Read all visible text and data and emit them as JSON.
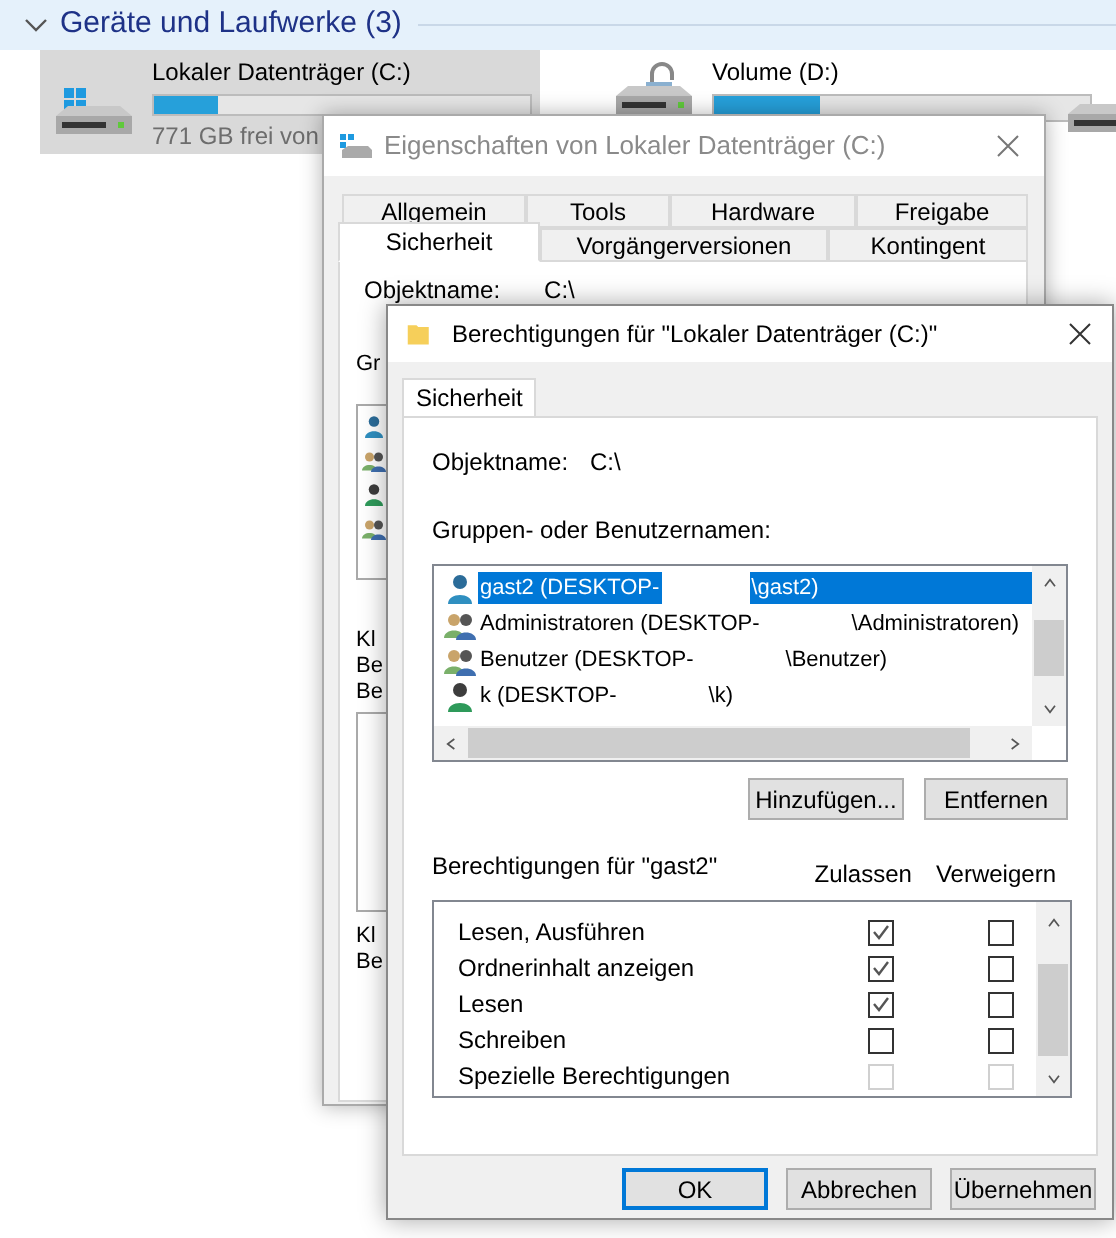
{
  "explorer": {
    "group_header": "Geräte und Laufwerke (3)",
    "expanded": true,
    "drives": [
      {
        "kind": "system",
        "name": "Lokaler Datenträger (C:)",
        "free": "771 GB frei von",
        "level": 0.17,
        "selected": true
      },
      {
        "kind": "locked",
        "name": "Volume (D:)",
        "level": 0.28,
        "selected": false
      }
    ]
  },
  "properties_window": {
    "title": "Eigenschaften von Lokaler Datenträger (C:)",
    "tab_rows": [
      [
        {
          "label": "Allgemein",
          "selected": false
        },
        {
          "label": "Tools",
          "selected": false
        },
        {
          "label": "Hardware",
          "selected": false
        },
        {
          "label": "Freigabe",
          "selected": false
        }
      ],
      [
        {
          "label": "Sicherheit",
          "selected": true
        },
        {
          "label": "Vorgängerversionen",
          "selected": false
        },
        {
          "label": "Kontingent",
          "selected": false
        }
      ]
    ],
    "object_label": "Objektname:",
    "object_value": "C:\\",
    "fragments_top": [
      "Gr"
    ],
    "fragments_mid": [
      "Kl",
      "Be",
      "Be"
    ],
    "fragments_bottom": [
      "Kl",
      "Be"
    ]
  },
  "permissions_window": {
    "title": "Berechtigungen für \"Lokaler Datenträger (C:)\"",
    "tabs": [
      {
        "label": "Sicherheit",
        "selected": true
      }
    ],
    "object_label": "Objektname:",
    "object_value": "C:\\",
    "groups_label": "Gruppen- oder Benutzernamen:",
    "principals": [
      {
        "kind": "user",
        "parts": [
          "gast2 (DESKTOP-",
          "\\gast2)"
        ],
        "selected": true
      },
      {
        "kind": "group",
        "parts": [
          "Administratoren (DESKTOP-",
          "\\Administratoren)"
        ],
        "selected": false
      },
      {
        "kind": "group",
        "parts": [
          "Benutzer (DESKTOP-",
          "\\Benutzer)"
        ],
        "selected": false
      },
      {
        "kind": "user2",
        "parts": [
          "k (DESKTOP-",
          "\\k)"
        ],
        "selected": false
      }
    ],
    "list_buttons": [
      "Hinzufügen...",
      "Entfernen"
    ],
    "permissions_label": "Berechtigungen für \"gast2\"",
    "columns": [
      "Zulassen",
      "Verweigern"
    ],
    "permissions": [
      {
        "label": "Lesen, Ausführen",
        "allow": {
          "checked": true,
          "disabled": false
        },
        "deny": {
          "checked": false,
          "disabled": false
        }
      },
      {
        "label": "Ordnerinhalt anzeigen",
        "allow": {
          "checked": true,
          "disabled": false
        },
        "deny": {
          "checked": false,
          "disabled": false
        }
      },
      {
        "label": "Lesen",
        "allow": {
          "checked": true,
          "disabled": false
        },
        "deny": {
          "checked": false,
          "disabled": false
        }
      },
      {
        "label": "Schreiben",
        "allow": {
          "checked": false,
          "disabled": false
        },
        "deny": {
          "checked": false,
          "disabled": false
        }
      },
      {
        "label": "Spezielle Berechtigungen",
        "allow": {
          "checked": false,
          "disabled": true
        },
        "deny": {
          "checked": false,
          "disabled": true
        }
      }
    ],
    "buttons": [
      {
        "label": "OK",
        "kind": "default"
      },
      {
        "label": "Abbrechen",
        "kind": "normal"
      },
      {
        "label": "Übernehmen",
        "kind": "normal"
      }
    ]
  }
}
